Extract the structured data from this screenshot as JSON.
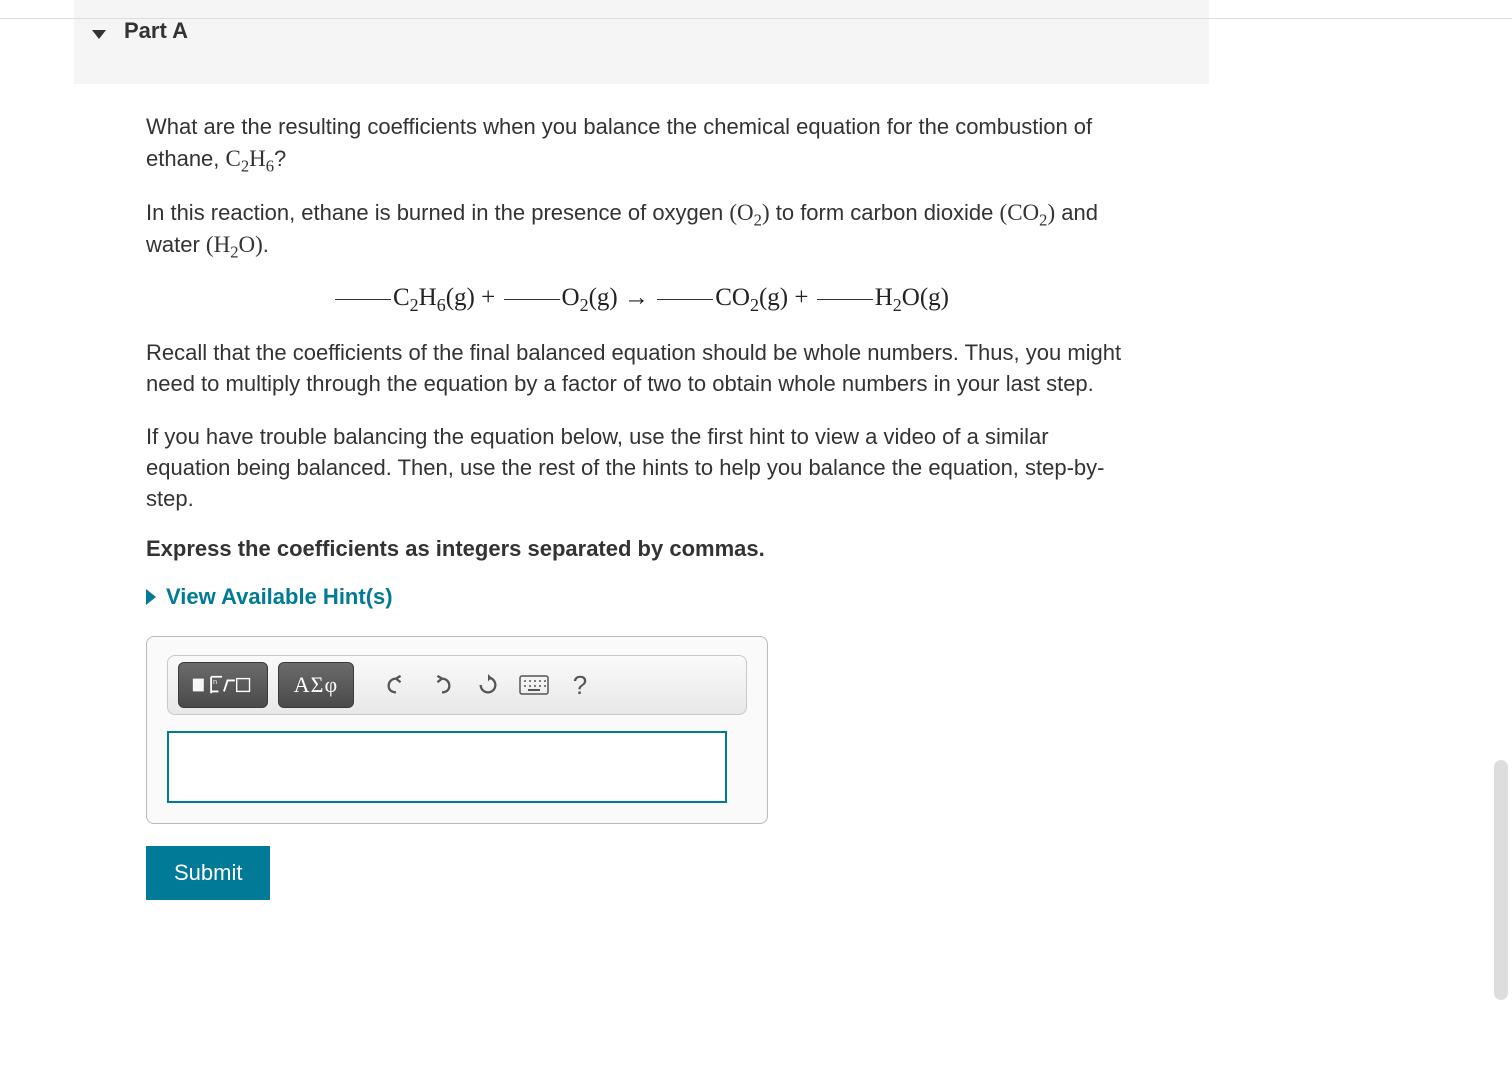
{
  "part": {
    "title": "Part A"
  },
  "question": {
    "p1_prefix": "What are the resulting coefficients when you balance the chemical equation for the combustion of ethane, ",
    "p1_formula_html": "C<sub>2</sub>H<sub>6</sub>",
    "p1_suffix": "?",
    "p2_prefix": "In this reaction, ethane is burned in the presence of oxygen ",
    "p2_o2_html": "(O<sub>2</sub>)",
    "p2_mid": " to form carbon dioxide ",
    "p2_co2_html": "(CO<sub>2</sub>)",
    "p2_and": " and water ",
    "p2_h2o_html": "(H<sub>2</sub>O)",
    "p2_end": ".",
    "eq": {
      "t1_html": "C<sub>2</sub>H<sub>6</sub>(g)",
      "plus": " + ",
      "t2_html": "O<sub>2</sub>(g)",
      "arrow": " → ",
      "t3_html": "CO<sub>2</sub>(g)",
      "t4_html": "H<sub>2</sub>O(g)"
    },
    "p3": "Recall that the coefficients of the final balanced equation should be whole numbers. Thus, you might need to multiply through the equation by a factor of two to obtain whole numbers in your last step.",
    "p4": "If you have trouble balancing the equation below, use the first hint to view a video of a similar equation being balanced. Then, use the rest of the hints to help you balance the equation, step-by-step.",
    "instruction": "Express the coefficients as integers separated by commas."
  },
  "hints": {
    "label": "View Available Hint(s)"
  },
  "toolbar": {
    "greek": "ΑΣφ",
    "help": "?"
  },
  "answer": {
    "value": ""
  },
  "submit": {
    "label": "Submit"
  }
}
